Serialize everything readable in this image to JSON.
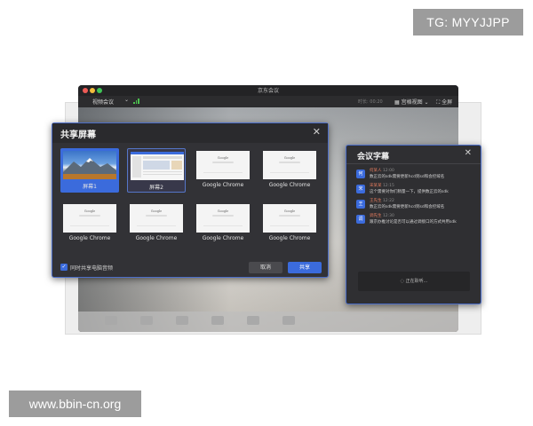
{
  "watermarks": {
    "top": "TG: MYYJJPP",
    "bottom": "www.bbin-cn.org"
  },
  "app": {
    "title": "京东会议",
    "toolbar": {
      "meeting_label": "视频会议",
      "duration": "时长: 00:20",
      "view_label": "宫格视图",
      "fullscreen_label": "全屏"
    }
  },
  "share_dialog": {
    "title": "共享屏幕",
    "close_icon": "close-icon",
    "items": [
      {
        "label": "屏幕1",
        "state": "selected"
      },
      {
        "label": "屏幕2",
        "state": "hover"
      },
      {
        "label": "Google Chrome",
        "state": "normal"
      },
      {
        "label": "Google Chrome",
        "state": "normal"
      },
      {
        "label": "Google Chrome",
        "state": "normal"
      },
      {
        "label": "Google Chrome",
        "state": "normal"
      },
      {
        "label": "Google Chrome",
        "state": "normal"
      },
      {
        "label": "Google Chrome",
        "state": "normal"
      }
    ],
    "share_audio_label": "同时共享电脑音频",
    "share_audio_checked": true,
    "cancel_label": "取消",
    "share_label": "共享"
  },
  "subtitles_panel": {
    "title": "会议字幕",
    "messages": [
      {
        "avatar": "何",
        "name": "何某人",
        "time": "12:00",
        "text": "数正云的sdk需要更新hcd到sd和会控域名"
      },
      {
        "avatar": "宋",
        "name": "宋某某",
        "time": "12:15",
        "text": "这个需要对你们稍量一下，提供数正云的sdk"
      },
      {
        "avatar": "王",
        "name": "王先生",
        "time": "12:22",
        "text": "数正云的sdk需要更新hcd到sd和会控域名"
      },
      {
        "avatar": "调",
        "name": "调先生",
        "time": "12:30",
        "text": "跟京办推讨论是否可以通过调接口的方式共用sdk"
      }
    ],
    "status_text": "正在聆听..."
  },
  "colors": {
    "accent": "#3b6bdc",
    "dialog_bg": "#323236",
    "name_color": "#e27b5e"
  }
}
